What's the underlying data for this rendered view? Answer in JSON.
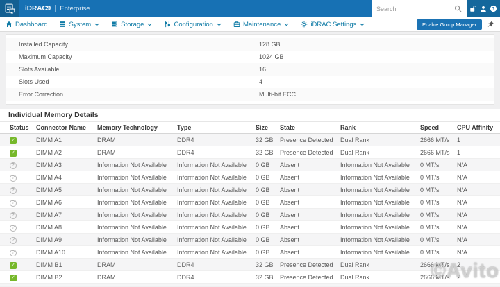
{
  "topbar": {
    "brand": "iDRAC9",
    "edition": "Enterprise",
    "search_placeholder": "Search",
    "icons": [
      "unlock-icon",
      "user-icon",
      "help-icon"
    ]
  },
  "nav": {
    "items": [
      {
        "label": "Dashboard",
        "icon": "home-icon",
        "dropdown": false
      },
      {
        "label": "System",
        "icon": "system-icon",
        "dropdown": true
      },
      {
        "label": "Storage",
        "icon": "storage-icon",
        "dropdown": true
      },
      {
        "label": "Configuration",
        "icon": "configuration-icon",
        "dropdown": true
      },
      {
        "label": "Maintenance",
        "icon": "maintenance-icon",
        "dropdown": true
      },
      {
        "label": "iDRAC Settings",
        "icon": "settings-icon",
        "dropdown": true
      }
    ],
    "group_manager_label": "Enable Group Manager"
  },
  "summary": {
    "rows": [
      {
        "label": "Installed Capacity",
        "value": "128 GB"
      },
      {
        "label": "Maximum Capacity",
        "value": "1024 GB"
      },
      {
        "label": "Slots Available",
        "value": "16"
      },
      {
        "label": "Slots Used",
        "value": "4"
      },
      {
        "label": "Error Correction",
        "value": "Multi-bit ECC"
      }
    ]
  },
  "memory": {
    "title": "Individual Memory Details",
    "columns": [
      "Status",
      "Connector Name",
      "Memory Technology",
      "Type",
      "Size",
      "State",
      "Rank",
      "Speed",
      "CPU Affinity"
    ],
    "rows": [
      {
        "status": "ok",
        "connector": "DIMM A1",
        "technology": "DRAM",
        "type": "DDR4",
        "size": "32 GB",
        "state": "Presence Detected",
        "rank": "Dual Rank",
        "speed": "2666 MT/s",
        "affinity": "1"
      },
      {
        "status": "ok",
        "connector": "DIMM A2",
        "technology": "DRAM",
        "type": "DDR4",
        "size": "32 GB",
        "state": "Presence Detected",
        "rank": "Dual Rank",
        "speed": "2666 MT/s",
        "affinity": "1"
      },
      {
        "status": "unknown",
        "connector": "DIMM A3",
        "technology": "Information Not Available",
        "type": "Information Not Available",
        "size": "0 GB",
        "state": "Absent",
        "rank": "Information Not Available",
        "speed": "0 MT/s",
        "affinity": "N/A"
      },
      {
        "status": "unknown",
        "connector": "DIMM A4",
        "technology": "Information Not Available",
        "type": "Information Not Available",
        "size": "0 GB",
        "state": "Absent",
        "rank": "Information Not Available",
        "speed": "0 MT/s",
        "affinity": "N/A"
      },
      {
        "status": "unknown",
        "connector": "DIMM A5",
        "technology": "Information Not Available",
        "type": "Information Not Available",
        "size": "0 GB",
        "state": "Absent",
        "rank": "Information Not Available",
        "speed": "0 MT/s",
        "affinity": "N/A"
      },
      {
        "status": "unknown",
        "connector": "DIMM A6",
        "technology": "Information Not Available",
        "type": "Information Not Available",
        "size": "0 GB",
        "state": "Absent",
        "rank": "Information Not Available",
        "speed": "0 MT/s",
        "affinity": "N/A"
      },
      {
        "status": "unknown",
        "connector": "DIMM A7",
        "technology": "Information Not Available",
        "type": "Information Not Available",
        "size": "0 GB",
        "state": "Absent",
        "rank": "Information Not Available",
        "speed": "0 MT/s",
        "affinity": "N/A"
      },
      {
        "status": "unknown",
        "connector": "DIMM A8",
        "technology": "Information Not Available",
        "type": "Information Not Available",
        "size": "0 GB",
        "state": "Absent",
        "rank": "Information Not Available",
        "speed": "0 MT/s",
        "affinity": "N/A"
      },
      {
        "status": "unknown",
        "connector": "DIMM A9",
        "technology": "Information Not Available",
        "type": "Information Not Available",
        "size": "0 GB",
        "state": "Absent",
        "rank": "Information Not Available",
        "speed": "0 MT/s",
        "affinity": "N/A"
      },
      {
        "status": "unknown",
        "connector": "DIMM A10",
        "technology": "Information Not Available",
        "type": "Information Not Available",
        "size": "0 GB",
        "state": "Absent",
        "rank": "Information Not Available",
        "speed": "0 MT/s",
        "affinity": "N/A"
      },
      {
        "status": "ok",
        "connector": "DIMM B1",
        "technology": "DRAM",
        "type": "DDR4",
        "size": "32 GB",
        "state": "Presence Detected",
        "rank": "Dual Rank",
        "speed": "2666 MT/s",
        "affinity": "2"
      },
      {
        "status": "ok",
        "connector": "DIMM B2",
        "technology": "DRAM",
        "type": "DDR4",
        "size": "32 GB",
        "state": "Presence Detected",
        "rank": "Dual Rank",
        "speed": "2666 MT/s",
        "affinity": "2"
      }
    ]
  },
  "colors": {
    "topbar": "#1771b4",
    "topbar_dark": "#135f92",
    "nav_accent": "#0f7ba6",
    "button": "#1b73b4",
    "status_ok": "#76b82a"
  },
  "watermark": "©Avito"
}
